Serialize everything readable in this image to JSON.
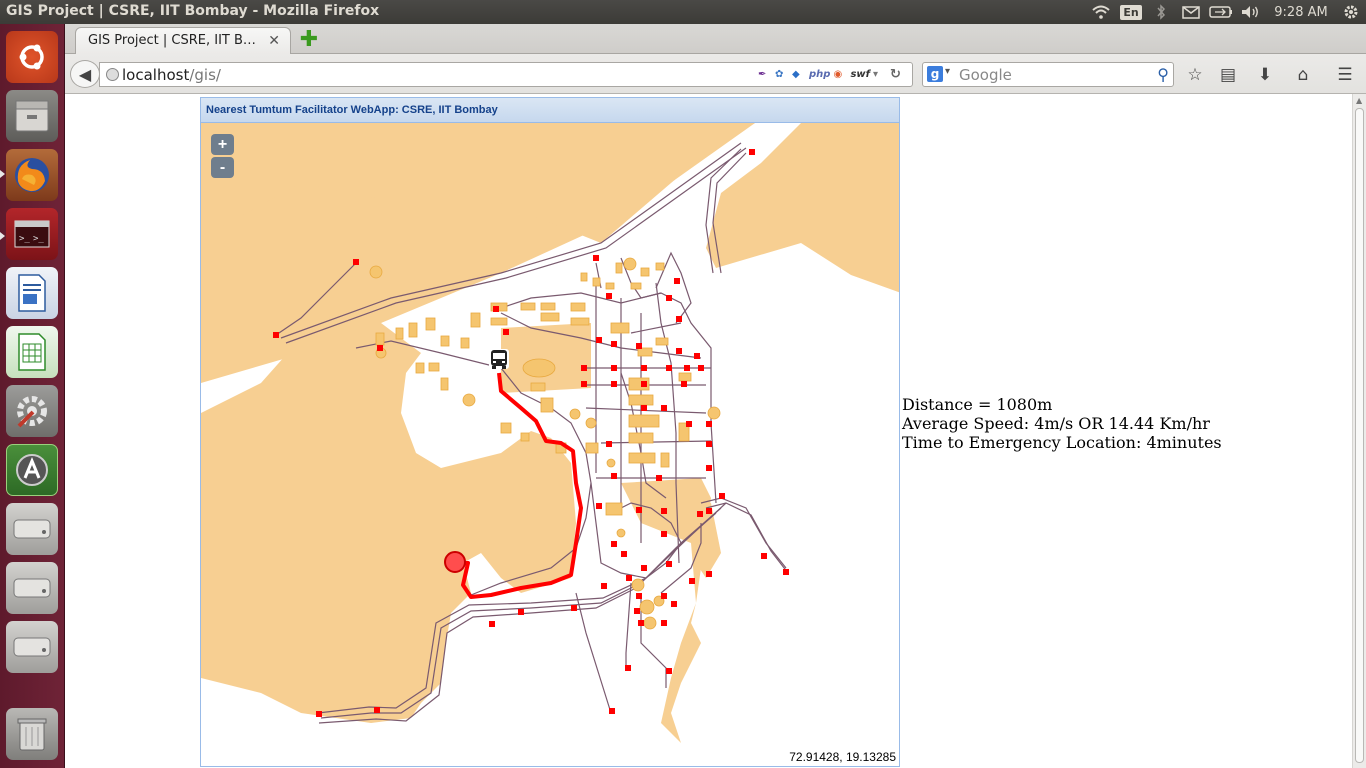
{
  "window": {
    "title": "GIS Project | CSRE, IIT Bombay - Mozilla Firefox"
  },
  "panel": {
    "language": "En",
    "clock": "9:28 AM",
    "icons": [
      "wifi-icon",
      "keyboard-lang-icon",
      "bluetooth-icon",
      "mail-icon",
      "battery-icon",
      "volume-icon",
      "settings-gear-icon"
    ]
  },
  "launcher": {
    "items": [
      "ubuntu-dash",
      "files",
      "firefox",
      "terminal",
      "libreoffice-writer",
      "libreoffice-calc",
      "system-settings",
      "software-updater",
      "drive-1",
      "drive-2",
      "drive-3",
      "trash"
    ]
  },
  "browser": {
    "tab_title": "GIS Project | CSRE, IIT B…",
    "url_host": "localhost",
    "url_path": "/gis/",
    "addons": [
      "feather-icon",
      "gear-icon",
      "cube-icon",
      "php",
      "ubuntu-icon",
      "swf"
    ],
    "search_placeholder": "Google",
    "search_engine_letter": "g"
  },
  "map": {
    "header": "Nearest Tumtum Facilitator WebApp: CSRE, IIT Bombay",
    "zoom_in": "+",
    "zoom_out": "-",
    "coordinates": "72.91428, 19.13285",
    "colors": {
      "land": "#f7cf92",
      "building": "#f5c56f",
      "building_stroke": "#e8a940",
      "road": "#7a5a6f",
      "node": "#ff0000",
      "route": "#ff0000"
    }
  },
  "info": {
    "distance": "Distance = 1080m",
    "speed": "Average Speed: 4m/s OR 14.44 Km/hr",
    "time": "Time to Emergency Location: 4minutes"
  }
}
